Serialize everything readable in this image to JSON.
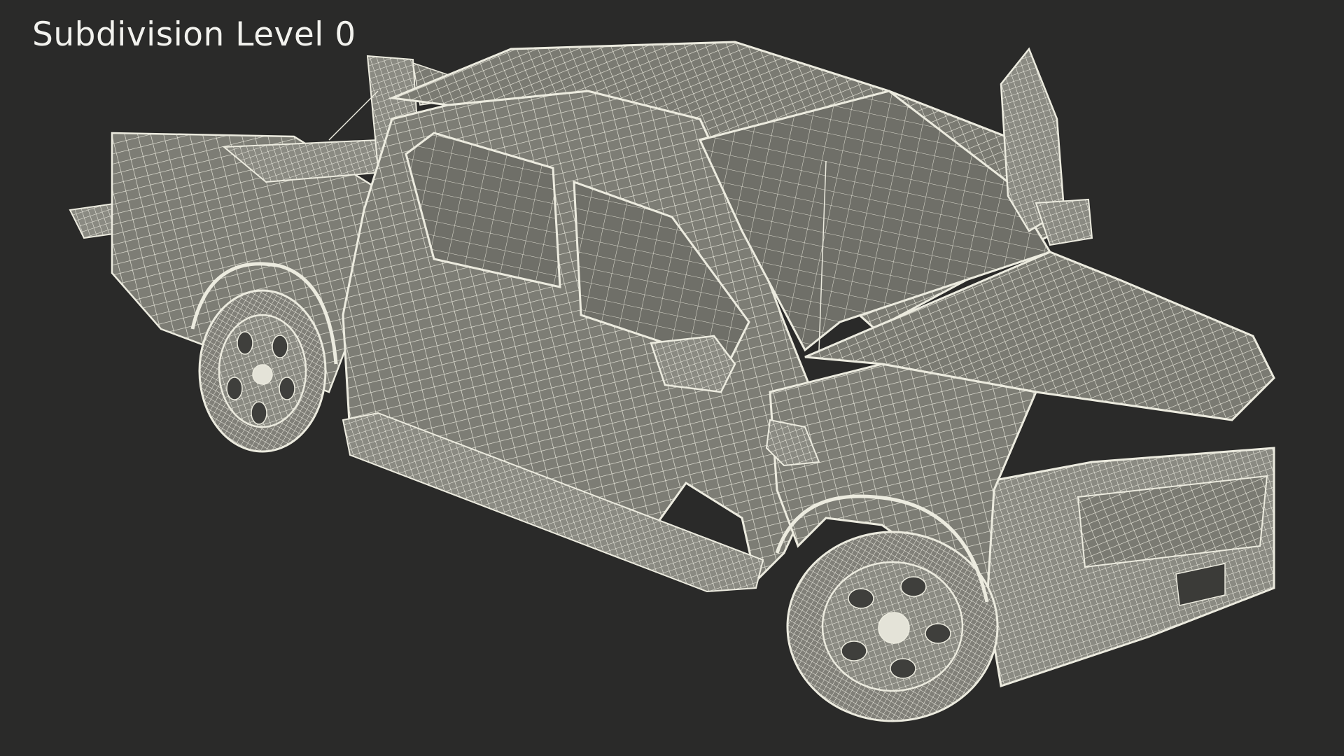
{
  "viewport": {
    "label": "Subdivision Level 0",
    "background_color": "#2a2a29",
    "mesh_fill_color": "#7b7b73",
    "wire_color": "#ecebdf",
    "text_color": "#f2f2ee"
  },
  "model": {
    "subject": "pickup truck wireframe mesh",
    "doors_open": [
      "driver side front door"
    ],
    "wheels_visible": 2
  }
}
